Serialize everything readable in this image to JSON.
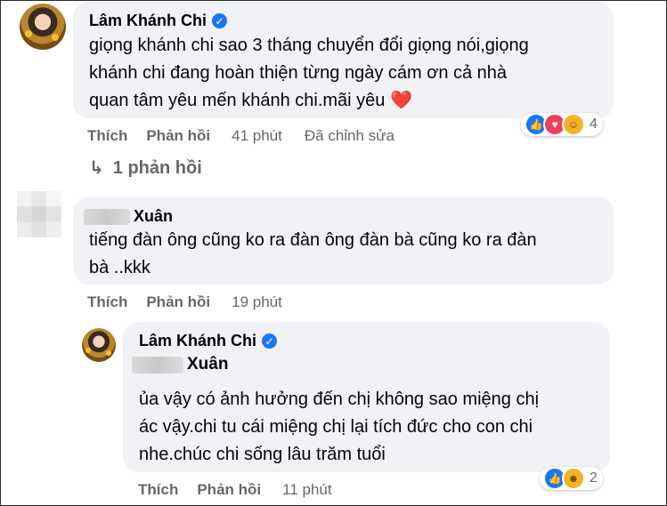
{
  "comments": [
    {
      "author": "Lâm Khánh Chi",
      "verified": true,
      "lines": [
        "giọng khánh chi sao 3 tháng chuyển đổi giọng nói,giọng",
        "khánh chi đang hoàn thiện từng ngày cám ơn cả nhà",
        "quan tâm yêu mến khánh chi.mãi yêu"
      ],
      "emoji": "❤️",
      "actions": {
        "like": "Thích",
        "reply": "Phản hồi",
        "time": "41 phút",
        "edited": "Đã chỉnh sửa"
      },
      "reactions": {
        "icons": [
          "like-icon",
          "love-icon",
          "care-icon"
        ],
        "count": "4"
      },
      "replies_link": "1 phản hồi"
    },
    {
      "author": "Xuân",
      "author_redacted": true,
      "lines": [
        "tiếng đàn ông cũng ko ra đàn ông đàn bà cũng ko ra đàn",
        "bà ..kkk"
      ],
      "actions": {
        "like": "Thích",
        "reply": "Phản hồi",
        "time": "19 phút"
      }
    },
    {
      "author": "Lâm Khánh Chi",
      "verified": true,
      "mention": "Xuân",
      "lines": [
        "ủa vậy có ảnh hưởng đến chị không sao miệng chị",
        "ác vậy.chi tu cái miệng chị lại tích đức cho con chi",
        "nhe.chúc chi sống lâu trăm tuổi"
      ],
      "actions": {
        "like": "Thích",
        "reply": "Phản hồi",
        "time": "11 phút"
      },
      "reactions": {
        "icons": [
          "like-icon",
          "haha-icon"
        ],
        "count": "2"
      }
    }
  ],
  "colors": {
    "bubble": "#f0f2f5",
    "text": "#050505",
    "secondary": "#65676b",
    "link_blue": "#1877f2",
    "heart_red": "#e41e3f"
  }
}
